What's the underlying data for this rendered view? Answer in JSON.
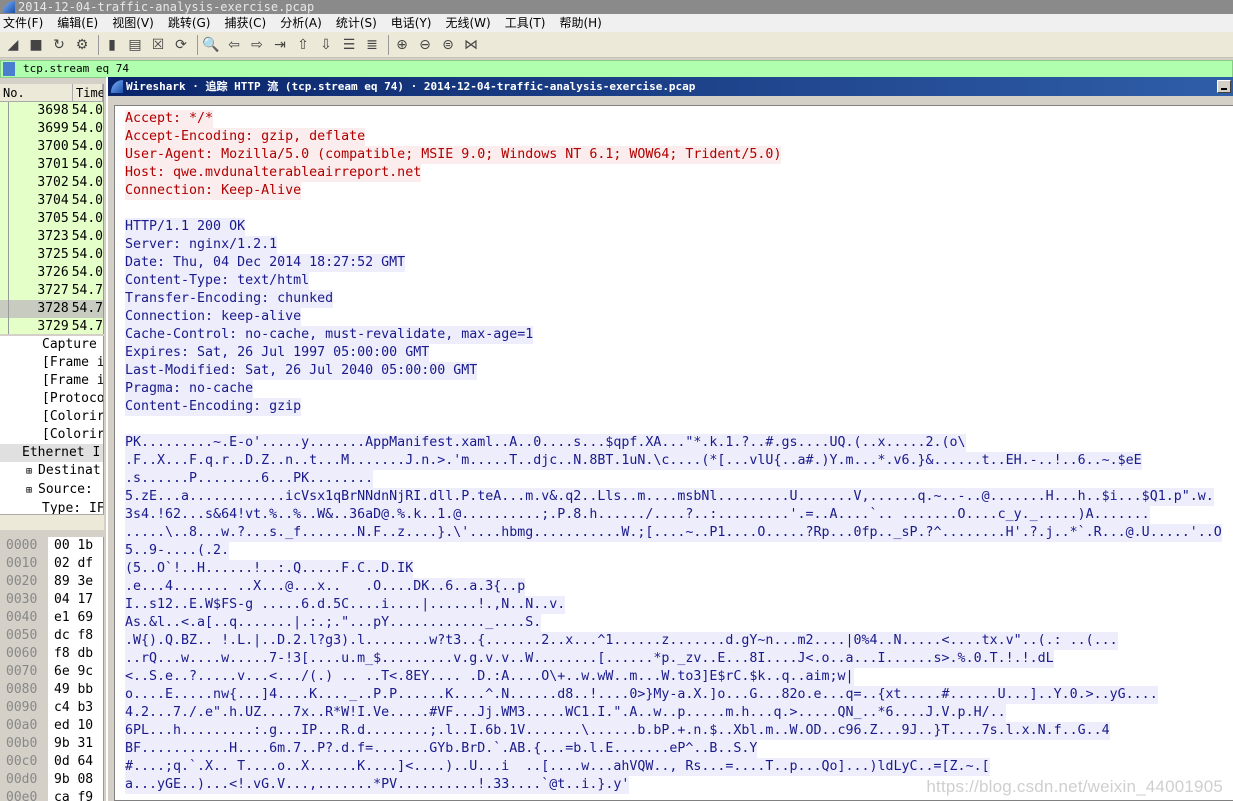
{
  "window_title": "2014-12-04-traffic-analysis-exercise.pcap",
  "menu": [
    "文件(F)",
    "编辑(E)",
    "视图(V)",
    "跳转(G)",
    "捕获(C)",
    "分析(A)",
    "统计(S)",
    "电话(Y)",
    "无线(W)",
    "工具(T)",
    "帮助(H)"
  ],
  "toolbar_icons": [
    "shark-fin-start-icon",
    "stop-icon",
    "restart-icon",
    "options-gear-icon",
    "open-folder-icon",
    "save-file-icon",
    "close-file-icon",
    "reload-icon",
    "find-icon",
    "back-arrow-icon",
    "forward-arrow-icon",
    "go-to-packet-icon",
    "first-packet-icon",
    "last-packet-icon",
    "autoscroll-icon",
    "colorize-icon",
    "zoom-in-icon",
    "zoom-out-icon",
    "normal-size-icon",
    "resize-columns-icon"
  ],
  "filter": {
    "value": "tcp.stream eq 74"
  },
  "packet_list": {
    "columns": [
      "No.",
      "Time"
    ],
    "rows": [
      {
        "no": "3698",
        "time": "54.0"
      },
      {
        "no": "3699",
        "time": "54.0"
      },
      {
        "no": "3700",
        "time": "54.0"
      },
      {
        "no": "3701",
        "time": "54.0"
      },
      {
        "no": "3702",
        "time": "54.0"
      },
      {
        "no": "3704",
        "time": "54.0"
      },
      {
        "no": "3705",
        "time": "54.0"
      },
      {
        "no": "3723",
        "time": "54.0"
      },
      {
        "no": "3725",
        "time": "54.0"
      },
      {
        "no": "3726",
        "time": "54.0"
      },
      {
        "no": "3727",
        "time": "54.7"
      },
      {
        "no": "3728",
        "time": "54.7"
      },
      {
        "no": "3729",
        "time": "54.7"
      }
    ],
    "selected": "3728"
  },
  "details": [
    "Capture",
    "[Frame i",
    "[Frame i",
    "[Protoco",
    "[Colorir",
    "[Colorir",
    "Ethernet I",
    "Destinat",
    "Source: ",
    "Type: IF"
  ],
  "hex": [
    {
      "off": "0000",
      "b": "00 1b"
    },
    {
      "off": "0010",
      "b": "02 df"
    },
    {
      "off": "0020",
      "b": "89 3e"
    },
    {
      "off": "0030",
      "b": "04 17"
    },
    {
      "off": "0040",
      "b": "e1 69"
    },
    {
      "off": "0050",
      "b": "dc f8"
    },
    {
      "off": "0060",
      "b": "f8 db"
    },
    {
      "off": "0070",
      "b": "6e 9c"
    },
    {
      "off": "0080",
      "b": "49 bb"
    },
    {
      "off": "0090",
      "b": "c4 b3"
    },
    {
      "off": "00a0",
      "b": "ed 10"
    },
    {
      "off": "00b0",
      "b": "9b 31"
    },
    {
      "off": "00c0",
      "b": "0d 64"
    },
    {
      "off": "00d0",
      "b": "9b 08"
    },
    {
      "off": "00e0",
      "b": "ca f9"
    }
  ],
  "dialog": {
    "title": "Wireshark · 追踪 HTTP 流 (tcp.stream eq 74) · 2014-12-04-traffic-analysis-exercise.pcap",
    "client_color": "#b00000",
    "server_color": "#1a1a8c",
    "client_lines": [
      "Accept: */*",
      "Accept-Encoding: gzip, deflate",
      "User-Agent: Mozilla/5.0 (compatible; MSIE 9.0; Windows NT 6.1; WOW64; Trident/5.0)",
      "Host: qwe.mvdunalterableairreport.net",
      "Connection: Keep-Alive"
    ],
    "server_headers": [
      "HTTP/1.1 200 OK",
      "Server: nginx/1.2.1",
      "Date: Thu, 04 Dec 2014 18:27:52 GMT",
      "Content-Type: text/html",
      "Transfer-Encoding: chunked",
      "Connection: keep-alive",
      "Cache-Control: no-cache, must-revalidate, max-age=1",
      "Expires: Sat, 26 Jul 1997 05:00:00 GMT",
      "Last-Modified: Sat, 26 Jul 2040 05:00:00 GMT",
      "Pragma: no-cache",
      "Content-Encoding: gzip"
    ],
    "server_body": [
      "PK.........~.E-o'.....y.......AppManifest.xaml..A..0....s...$qpf.XA...\"*.k.1.?..#.gs....UQ.(..x.....2.(o\\",
      ".F..X...F.q.r..D.Z..n..t...M.......J.n.>.'m.....T..djc..N.8BT.1uN.\\c....(*[...vlU{..a#.)Y.m...*.v6.}&......t..EH.-..!..6..~.$eE",
      ".s......P........6...PK........",
      "5.zE...a............icVsx1qBrNNdnNjRI.dll.P.teA...m.v&.q2..Lls..m....msbNl.........U.......V,......q.~..-..@.......H...h..$i...$Q1.p\".w.",
      "3s4.!62...s&64!vt.%..%..W&..36aD@.%.k..1.@..........;.P.8.h....../....?..:.........'.=..A....`.. .......O....c_y._.....)A.......",
      ".....\\..8...w.?...s._f.......N.F..z....}.\\'....hbmg...........W.;[....~..P1....O.....?Rp...0fp.._sP.?^........H'.?.j..*`.R...@.U.....'..O",
      "5..9-....(.2.",
      "(5..O`!..H......!..:.Q.....F.C..D.IK",
      ".e...4....... ..X...@...x..   .O....DK..6..a.3{..p",
      "I..s12..E.W$FS-g .....6.d.5C....i....|......!.,N..N..v.",
      "As.&l..<.a[..q.......|.:.;.\"...pY............_....S.",
      ".W{).Q.BZ.. !.L.|..D.2.l?g3).l........w?t3..{.......2..x...^1......z.......d.gY~n...m2....|0%4..N.....<....tx.v\"..(.: ..(...",
      "..rQ...w....w.....7-!3[....u.m_$.........v.g.v.v..W........[......*p._zv..E...8I....J<.o..a...I......s>.%.0.T.!.!.dL",
      "<..S.e..?.....v...<.../(.) .. ..T<.8EY.... .D.:A....O\\+..w.wW..m...W.to3]E$rC.$k..q..aim;w|",
      "o....E.....nw{...]4....K...._..P.P......K....^.N......d8..!....0>}My-a.X.]o...G...82o.e...q=..{xt.....#......U...]..Y.0.>..yG....",
      "4.2...7./.e\".h.UZ....7x..R*W!I.Ve.....#VF...Jj.WM3.....WC1.I.\".A..w..p.....m.h...q.>.....QN_..*6....J.V.p.H/..",
      "6PL...h.........:.g...IP...R.d........;.l..I.6b.1V.......\\......b.bP.+.n.$..Xbl.m..W.OD..c96.Z...9J..}T....7s.l.x.N.f..G..4",
      "BF...........H....6m.7..P?.d.f=.......GYb.BrD.`.AB.{...=b.l.E.......eP^..B..S.Y",
      "#....;q.`.X.. T....o..X......K....]<....)..U...i  ..[....w...ahVQW.., Rs...=....T..p...Qo]...)ldLyC..=[Z.~.[",
      "a...yGE..)...<!.vG.V...,.......*PV..........!.33....`@t..i.}.y'"
    ]
  },
  "watermark": "https://blog.csdn.net/weixin_44001905"
}
